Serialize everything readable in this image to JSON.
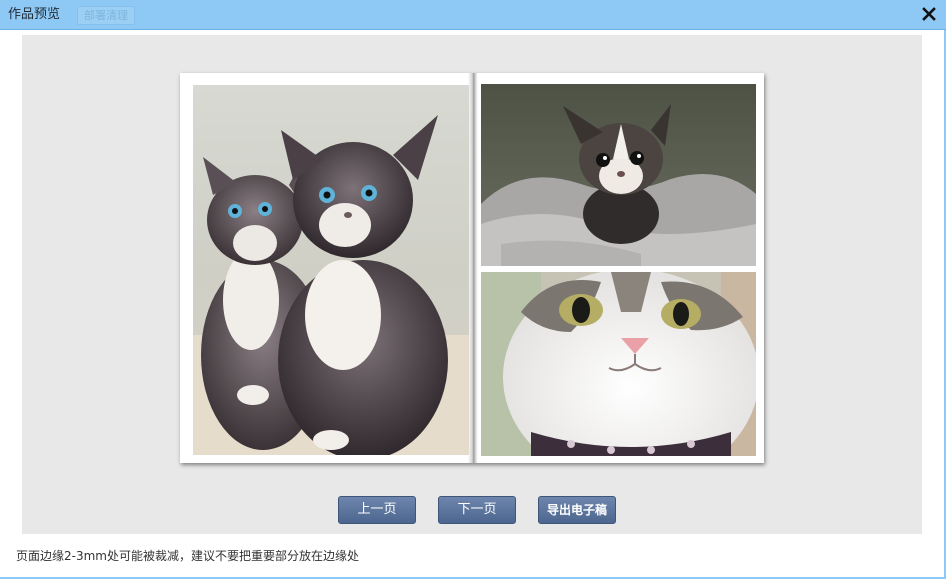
{
  "window": {
    "title": "作品预览",
    "ghost_button_label": "部署清理",
    "close_icon": "close-icon"
  },
  "preview": {
    "photos": [
      {
        "name": "photo-two-kittens",
        "subject": "two fluffy kittens"
      },
      {
        "name": "photo-kitten-in-blanket",
        "subject": "kitten in a grey blanket"
      },
      {
        "name": "photo-cat-closeup",
        "subject": "close-up of a white and tabby cat face"
      }
    ]
  },
  "controls": {
    "prev_label": "上一页",
    "next_label": "下一页",
    "export_label": "导出电子稿"
  },
  "footer": {
    "note": "页面边缘2-3mm处可能被裁减，建议不要把重要部分放在边缘处"
  },
  "colors": {
    "titlebar": "#8ec8f4",
    "button": "#5a7299",
    "preview_bg": "#e8e8e8"
  }
}
